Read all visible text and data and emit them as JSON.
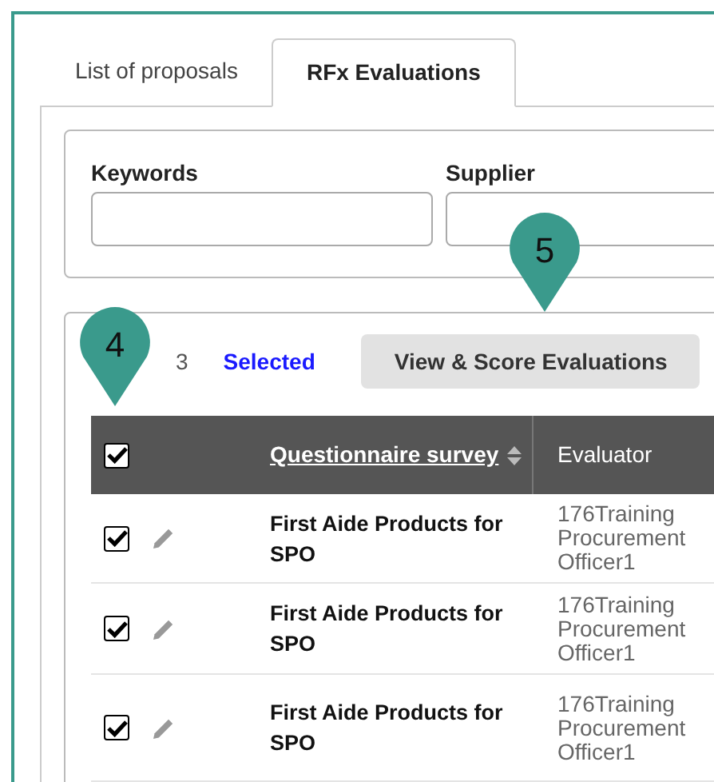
{
  "tabs": [
    {
      "label": "List of proposals",
      "selected": false
    },
    {
      "label": "RFx Evaluations",
      "selected": true
    }
  ],
  "filters": [
    {
      "label": "Keywords"
    },
    {
      "label": "Supplier"
    }
  ],
  "selection": {
    "count": "3",
    "label": "Selected"
  },
  "action_button": "View & Score Evaluations",
  "table": {
    "select_all_checked": true,
    "columns": [
      {
        "label": "Questionnaire survey",
        "sortable": true
      },
      {
        "label": "Evaluator",
        "sortable": false
      }
    ],
    "rows": [
      {
        "checked": true,
        "questionnaire": "First Aide Products for SPO",
        "evaluator": "176Training ProcurementOfficer1"
      },
      {
        "checked": true,
        "questionnaire": "First Aide Products for SPO",
        "evaluator": "176Training ProcurementOfficer1"
      },
      {
        "checked": true,
        "questionnaire": "First Aide Products for SPO",
        "evaluator": "176Training ProcurementOfficer1"
      }
    ]
  },
  "callouts": [
    {
      "label": "4"
    },
    {
      "label": "5"
    }
  ]
}
